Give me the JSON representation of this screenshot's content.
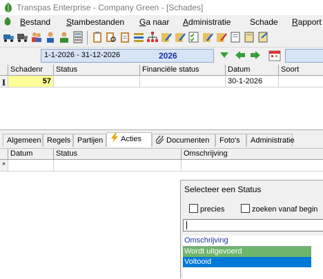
{
  "window": {
    "title": "Transpas Enterprise - Company Green - [Schades]",
    "icon": "app-leaf-icon"
  },
  "menu": [
    {
      "label_ul": "B",
      "label_rest": "estand"
    },
    {
      "label_ul": "S",
      "label_rest": "tambestanden"
    },
    {
      "label_ul": "G",
      "label_rest": "a naar"
    },
    {
      "label_ul": "A",
      "label_rest": "dministratie"
    },
    {
      "label_ul": "",
      "label_rest": "Schade"
    },
    {
      "label_ul": "R",
      "label_rest": "apport"
    }
  ],
  "toolbar": {
    "icons": [
      "truck-icon",
      "truck2-icon",
      "users-icon",
      "person-icon",
      "people-icon",
      "calculator-icon",
      "clipboard-icon",
      "clipboard-search-icon",
      "clipboard-copy-icon",
      "gear-list-icon",
      "org-chart-icon",
      "pencil-doc-icon",
      "pencil-doc2-icon",
      "checklist-icon",
      "pencil-doc3-icon",
      "edit-icon",
      "doc-icon",
      "doc2-icon",
      "doc3-icon"
    ]
  },
  "period": {
    "range": "1-1-2026 - 31-12-2026",
    "year": "2026"
  },
  "grid": {
    "columns": [
      "Schadenr",
      "Status",
      "Financiële status",
      "Datum",
      "Soort"
    ],
    "rows": [
      {
        "schadenr": "57",
        "status": "",
        "fin_status": "",
        "datum": "30-1-2026",
        "soort": ""
      }
    ]
  },
  "tabs": [
    "Algemeen",
    "Regels",
    "Partijen",
    "Acties",
    "Documenten",
    "Foto's",
    "Administratie"
  ],
  "active_tab": "Acties",
  "detail": {
    "columns": [
      "Datum",
      "Status",
      "Omschrijving"
    ],
    "new_row_marker": "*"
  },
  "status_popup": {
    "title": "Selecteer een Status",
    "checkbox_precies": "precies",
    "checkbox_zoeken": "zoeken vanaf begin",
    "search_value": "",
    "list_header": "Omschrijving",
    "items": [
      {
        "label": "Wordt uitgevoerd",
        "color": "#6db56b"
      },
      {
        "label": "Voltooid",
        "color": "#0078d7"
      }
    ]
  },
  "colors": {
    "highlight_cell": "#ffff99",
    "period_field": "#d6e4f5"
  }
}
